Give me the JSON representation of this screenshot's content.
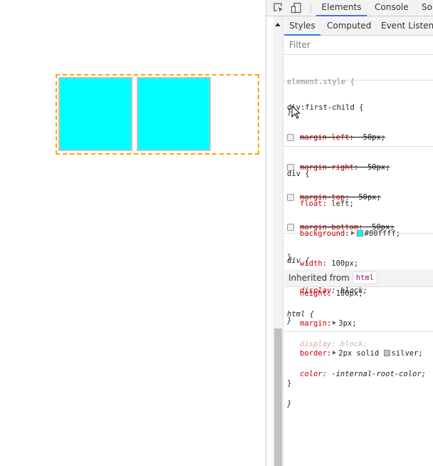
{
  "page": {
    "container_border_color": "#ffa500",
    "box_color": "#00ffff",
    "box_border_color": "#c0c0c0",
    "box_count": 2
  },
  "devtools": {
    "toolbar": {
      "icons": [
        "inspect-element-icon",
        "device-toolbar-icon"
      ],
      "tabs": [
        "Elements",
        "Console",
        "Sou"
      ],
      "active_tab": "Elements"
    },
    "subtabs": [
      "Styles",
      "Computed",
      "Event Listener"
    ],
    "active_subtab": "Styles",
    "filter_placeholder": "Filter",
    "rules": {
      "element_style": {
        "selector": "element.style {",
        "close": "}"
      },
      "first_child": {
        "selector": "div:first-child {",
        "props": [
          {
            "name": "margin-left",
            "value": "50px;",
            "checked": false
          },
          {
            "name": "margin-right",
            "value": "50px;",
            "checked": false
          },
          {
            "name": "margin-top",
            "value": "50px;",
            "checked": false
          },
          {
            "name": "margin-bottom",
            "value": "50px;",
            "checked": false
          }
        ],
        "close": "}"
      },
      "div": {
        "selector": "div {",
        "float": {
          "name": "float",
          "value": "left;"
        },
        "background": {
          "name": "background",
          "value": "#00ffff;",
          "swatch": "#00ffff"
        },
        "width": {
          "name": "width",
          "value": "100px;"
        },
        "height": {
          "name": "height",
          "value": "100px;"
        },
        "margin": {
          "name": "margin",
          "value": "3px;"
        },
        "border": {
          "name": "border",
          "value": "2px solid",
          "color_value": "silver;",
          "swatch": "#c0c0c0"
        },
        "close": "}"
      },
      "ua_div": {
        "selector": "div {",
        "name": "display",
        "value": "block;",
        "close": "}"
      },
      "inherited": {
        "label": "Inherited from",
        "tag": "html"
      },
      "html": {
        "selector": "html {",
        "display": {
          "name": "display",
          "value": "block;"
        },
        "color": {
          "name": "color",
          "value": "-internal-root-color;"
        },
        "close": "}"
      }
    }
  }
}
